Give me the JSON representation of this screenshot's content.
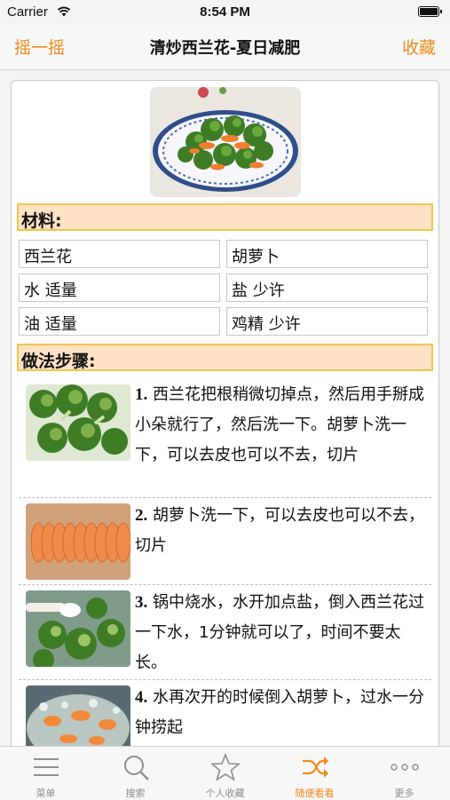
{
  "status_bar": {
    "carrier": "Carrier",
    "time": "8:54 PM"
  },
  "nav": {
    "left_label": "摇一摇",
    "title": "清炒西兰花-夏日减肥",
    "right_label": "收藏"
  },
  "ingredients": {
    "header": "材料:",
    "items": [
      "西兰花",
      "胡萝卜",
      "水 适量",
      "盐 少许",
      "油 适量",
      "鸡精 少许"
    ]
  },
  "steps": {
    "header": "做法步骤:",
    "items": [
      {
        "num": "1.",
        "text": "西兰花把根稍微切掉点，然后用手掰成小朵就行了，然后洗一下。胡萝卜洗一下，可以去皮也可以不去，切片"
      },
      {
        "num": "2.",
        "text": "胡萝卜洗一下，可以去皮也可以不去，切片"
      },
      {
        "num": "3.",
        "text": "锅中烧水，水开加点盐，倒入西兰花过一下水，1分钟就可以了，时间不要太长。"
      },
      {
        "num": "4.",
        "text": "水再次开的时候倒入胡萝卜，过水一分钟捞起"
      }
    ]
  },
  "tabbar": {
    "items": [
      {
        "label": "菜单",
        "icon": "menu-lines-icon"
      },
      {
        "label": "搜索",
        "icon": "search-icon"
      },
      {
        "label": "个人收藏",
        "icon": "star-icon"
      },
      {
        "label": "随便看看",
        "icon": "shuffle-icon"
      },
      {
        "label": "更多",
        "icon": "more-dots-icon"
      }
    ],
    "active_index": 3
  },
  "colors": {
    "accent": "#f08a1c",
    "section_bg": "#fde2c5",
    "section_border": "#f3c64a",
    "inactive_tab": "#8e8e8e"
  }
}
